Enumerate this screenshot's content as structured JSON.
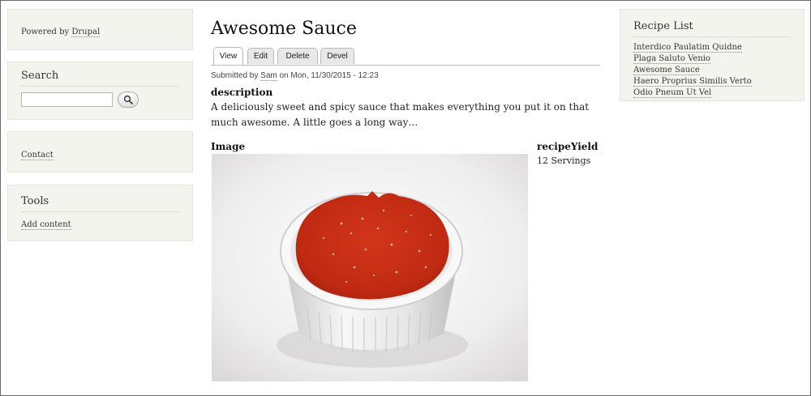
{
  "powered_by": {
    "prefix": "Powered by ",
    "link": "Drupal"
  },
  "search": {
    "title": "Search",
    "value": "",
    "placeholder": ""
  },
  "contact": {
    "link": "Contact"
  },
  "tools": {
    "title": "Tools",
    "add_content": "Add content"
  },
  "recipe_list": {
    "title": "Recipe List",
    "items": [
      "Interdico Paulatim Quidne",
      "Plaga Saluto Venio",
      "Awesome Sauce",
      "Haero Proprius Similis Verto",
      "Odio Pneum Ut Vel"
    ]
  },
  "node": {
    "title": "Awesome Sauce",
    "tabs": [
      "View",
      "Edit",
      "Delete",
      "Devel"
    ],
    "active_tab": "View",
    "submitted": {
      "prefix": "Submitted by ",
      "user": "Sam",
      "suffix": " on Mon, 11/30/2015 - 12:23"
    },
    "description_label": "description",
    "description": "A deliciously sweet and spicy sauce that makes everything you put it on that much awesome. A little goes a long way…",
    "image_label": "Image",
    "yield_label": "recipeYield",
    "yield_value": "12 Servings"
  },
  "colors": {
    "sidebar_bg": "#f4f4ef",
    "sauce_red": "#c42b14",
    "ramekin_white": "#f2f2f2"
  },
  "icons": {
    "search_button": "magnifier-icon"
  }
}
